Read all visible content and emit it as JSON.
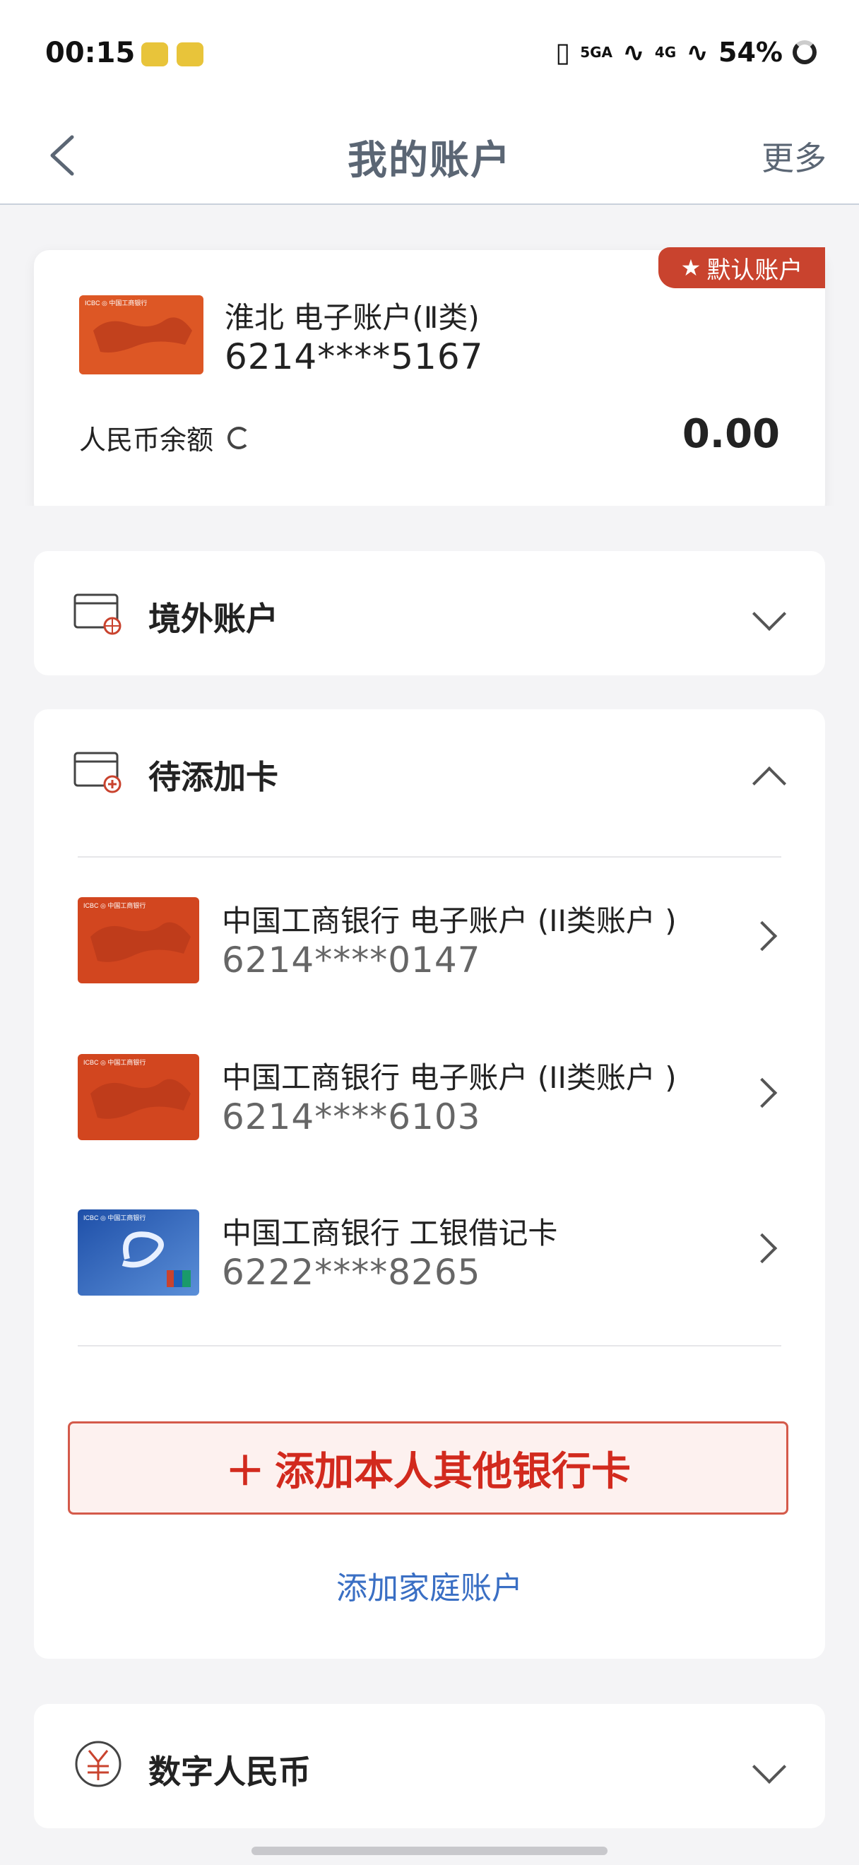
{
  "status_bar": {
    "time": "00:15",
    "signal1": "5GA",
    "signal2": "4G",
    "battery": "54%"
  },
  "nav": {
    "title": "我的账户",
    "more": "更多"
  },
  "default_account": {
    "badge": "默认账户",
    "name": "淮北 电子账户(Ⅱ类)",
    "number": "6214****5167",
    "balance_label": "人民币余额",
    "balance": "0.00"
  },
  "overseas": {
    "title": "境外账户"
  },
  "pending": {
    "title": "待添加卡",
    "cards": [
      {
        "title": "中国工商银行 电子账户 (II类账户 )",
        "number": "6214****0147",
        "type": "red"
      },
      {
        "title": "中国工商银行 电子账户 (II类账户 )",
        "number": "6214****6103",
        "type": "red"
      },
      {
        "title": "中国工商银行 工银借记卡",
        "number": "6222****8265",
        "type": "blue"
      }
    ],
    "add_button": "添加本人其他银行卡",
    "add_family": "添加家庭账户"
  },
  "digital_rmb": {
    "title": "数字人民币"
  },
  "colors": {
    "accent_red": "#d22a1e",
    "badge_red": "#c9432e",
    "link_blue": "#3a6fc4"
  }
}
